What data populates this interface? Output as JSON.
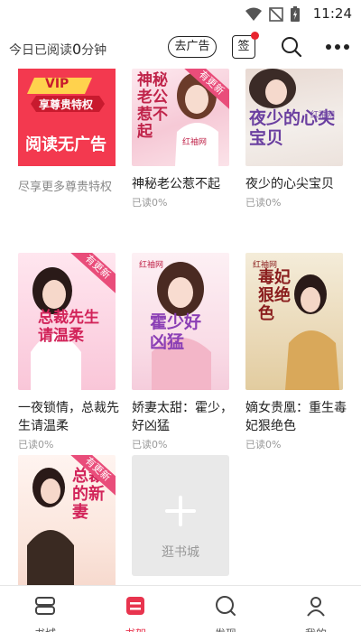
{
  "status_bar": {
    "time": "11:24"
  },
  "header": {
    "reading_prefix": "今日已阅读",
    "reading_minutes": "0",
    "reading_suffix": "分钟",
    "ad_button": "去广告",
    "sign_button": "签"
  },
  "vip_promo": {
    "vip": "VIP",
    "ribbon": "享尊贵特权",
    "headline": "阅读无广告",
    "caption": "尽享更多尊贵特权"
  },
  "books": [
    {
      "title": "神秘老公惹不起",
      "progress": "已读0%",
      "cover_text": "神秘老公惹不起",
      "publisher": "红袖网",
      "badge": "有更新"
    },
    {
      "title": "夜少的心尖宝贝",
      "progress": "已读0%",
      "cover_text": "夜少的心尖宝贝",
      "publisher": "红袖网",
      "badge": ""
    },
    {
      "title": "一夜锁情，总裁先生请温柔",
      "progress": "已读0%",
      "cover_text": "总裁先生请温柔",
      "publisher": "",
      "badge": "有更新"
    },
    {
      "title": "娇妻太甜：霍少，好凶猛",
      "progress": "已读0%",
      "cover_text": "霍少好凶猛",
      "publisher": "红袖网",
      "badge": ""
    },
    {
      "title": "嫡女贵凰：重生毒妃狠绝色",
      "progress": "已读0%",
      "cover_text": "毒妃狠绝色",
      "publisher": "红袖网",
      "badge": ""
    },
    {
      "title": "",
      "progress": "",
      "cover_text": "总裁的新妻",
      "publisher": "",
      "badge": "有更新"
    }
  ],
  "add_book": {
    "label": "逛书城"
  },
  "bottom_nav": [
    {
      "label": "书城",
      "icon": "bookstore-icon"
    },
    {
      "label": "书架",
      "icon": "bookshelf-icon",
      "active": true
    },
    {
      "label": "发现",
      "icon": "discover-icon"
    },
    {
      "label": "我的",
      "icon": "profile-icon"
    }
  ],
  "colors": {
    "accent": "#e8344e",
    "vip_red": "#f3394f",
    "badge_pink": "#e94d7a"
  }
}
